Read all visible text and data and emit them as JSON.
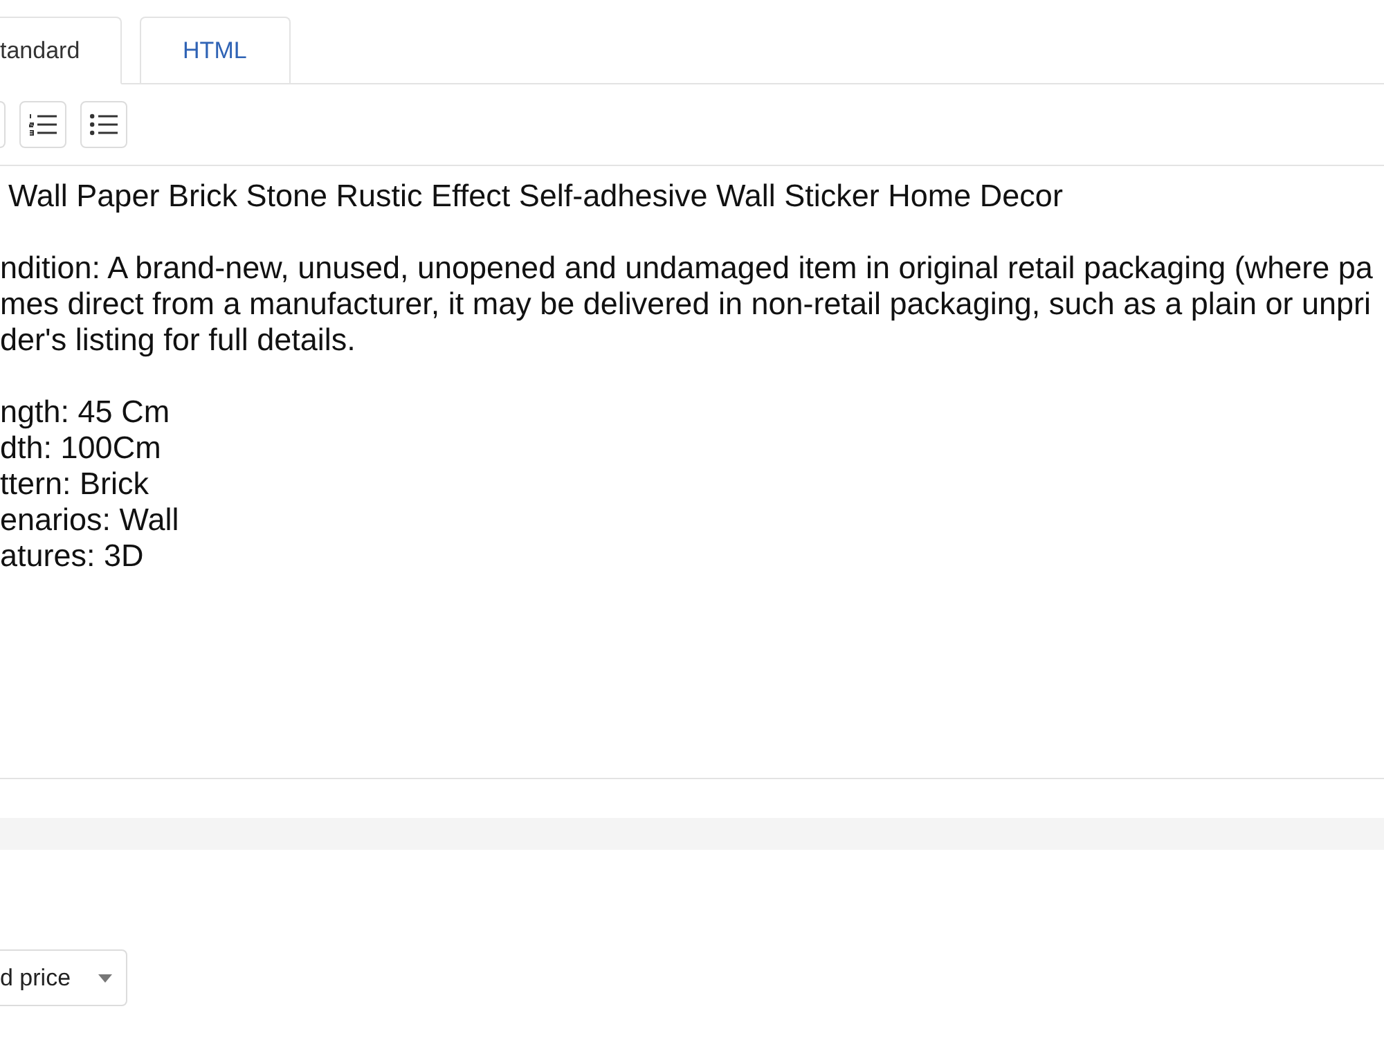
{
  "tabs": [
    {
      "label": "tandard",
      "selected": true
    },
    {
      "label": "HTML",
      "selected": false
    }
  ],
  "toolbar": {
    "buttons": [
      {
        "kind": "cut-off"
      },
      {
        "kind": "numbered-list"
      },
      {
        "kind": "bulleted-list"
      }
    ]
  },
  "editor": {
    "blocks": [
      [
        "Wall Paper Brick Stone Rustic Effect Self-adhesive Wall Sticker Home Decor"
      ],
      [
        "ndition: A brand-new, unused, unopened and undamaged item in original retail packaging (where pa",
        "mes direct from a manufacturer, it may be delivered in non-retail packaging, such as a plain or unpri",
        "der's listing for full details."
      ],
      [
        "ngth: 45 Cm",
        "dth: 100Cm",
        "ttern: Brick",
        "enarios: Wall",
        "atures: 3D"
      ]
    ]
  },
  "price_select": {
    "value": "d price"
  }
}
